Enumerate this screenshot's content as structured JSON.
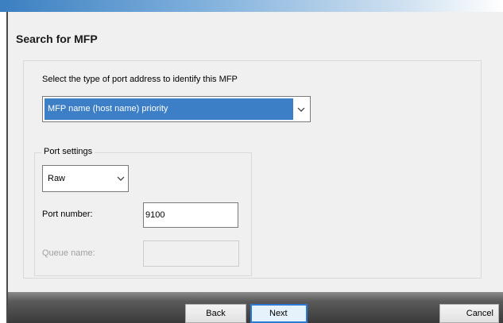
{
  "dialog": {
    "title": "Search for MFP",
    "prompt": "Select the type of port address to identify this MFP",
    "port_type_select": {
      "value": "MFP name (host name) priority",
      "icon": "chevron-down-icon"
    },
    "port_settings": {
      "legend": "Port settings",
      "protocol_select": {
        "value": "Raw",
        "icon": "chevron-down-icon"
      },
      "port_number_label": "Port number:",
      "port_number_value": "9100",
      "queue_name_label": "Queue name:",
      "queue_name_value": ""
    }
  },
  "footer": {
    "back_label": "Back",
    "next_label": "Next",
    "cancel_label": "Cancel"
  },
  "colors": {
    "selection": "#3c7fc7",
    "focus_border": "#2b7bd6",
    "disabled_text": "#a0a0a0"
  }
}
